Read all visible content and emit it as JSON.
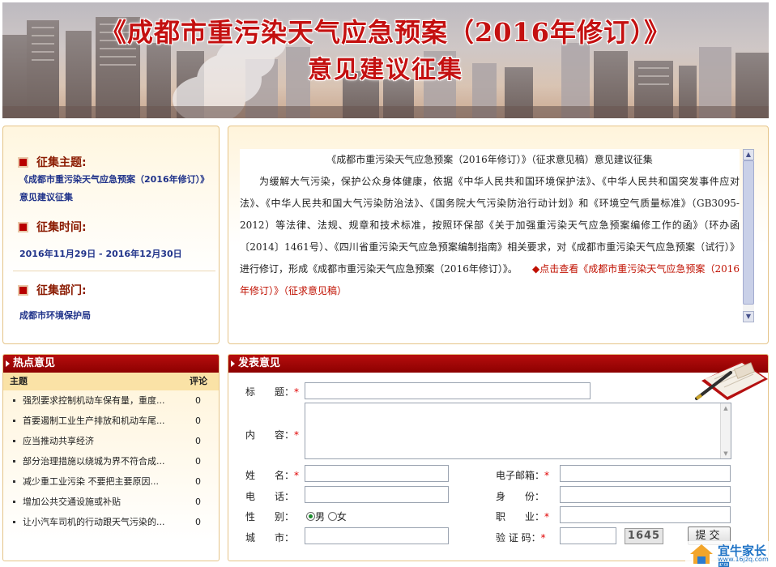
{
  "banner": {
    "title_line1": "《成都市重污染天气应急预案（2016年修订）》",
    "title_line2": "意见建议征集"
  },
  "info": {
    "theme_label": "征集主题:",
    "theme_value": "《成都市重污染天气应急预案（2016年修订）》意见建议征集",
    "time_label": "征集时间:",
    "time_value": "2016年11月29日 - 2016年12月30日",
    "dept_label": "征集部门:",
    "dept_value": "成都市环境保护局"
  },
  "intro": {
    "title": "《成都市重污染天气应急预案（2016年修订）》（征求意见稿）意见建议征集",
    "body": "为缓解大气污染，保护公众身体健康，依据《中华人民共和国环境保护法》、《中华人民共和国突发事件应对法》、《中华人民共和国大气污染防治法》、《国务院大气污染防治行动计划》和《环境空气质量标准》（GB3095-2012）等法律、法规、规章和技术标准，按照环保部《关于加强重污染天气应急预案编修工作的函》（环办函〔2014〕1461号）、《四川省重污染天气应急预案编制指南》相关要求，对《成都市重污染天气应急预案（试行）》进行修订，形成《成都市重污染天气应急预案（2016年修订）》。",
    "link": "◆点击查看《成都市重污染天气应急预案（2016年修订）》（征求意见稿）"
  },
  "hot": {
    "heading": "热点意见",
    "col_topic": "主题",
    "col_comments": "评论",
    "rows": [
      {
        "title": "强烈要求控制机动车保有量，重度...",
        "count": "0"
      },
      {
        "title": "首要遏制工业生产排放和机动车尾...",
        "count": "0"
      },
      {
        "title": "应当推动共享经济",
        "count": "0"
      },
      {
        "title": "部分治理措施以绕城为界不符合成...",
        "count": "0"
      },
      {
        "title": "减少重工业污染 不要把主要原因...",
        "count": "0"
      },
      {
        "title": "增加公共交通设施或补贴",
        "count": "0"
      },
      {
        "title": "让小汽车司机的行动跟天气污染的...",
        "count": "0"
      }
    ]
  },
  "form": {
    "heading": "发表意见",
    "title_label": "标　　题：",
    "content_label": "内　　容：",
    "name_label": "姓　　名：",
    "email_label": "电子邮箱：",
    "phone_label": "电　　话：",
    "identity_label": "身　　份：",
    "gender_label": "性　　别：",
    "gender_male": "男",
    "gender_female": "女",
    "job_label": "职　　业：",
    "city_label": "城　　市：",
    "captcha_label": "验 证 码：",
    "required_mark": "*",
    "captcha_code": "1645",
    "submit_label": "提交",
    "title_value": "",
    "content_value": "",
    "name_value": "",
    "email_value": "",
    "phone_value": "",
    "identity_value": "",
    "job_value": "",
    "city_value": "",
    "captcha_value": ""
  },
  "watermark": {
    "text": "宜牛家长圈",
    "sub": "www.16jzq.com"
  },
  "colors": {
    "accent_red": "#b70e0e",
    "link_blue": "#20338a",
    "panel_border": "#e5c488",
    "panel_bg": "#fff4db"
  }
}
